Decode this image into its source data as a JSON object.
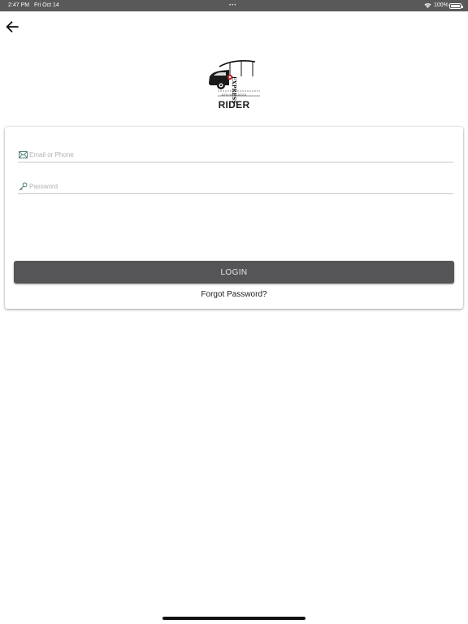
{
  "status_bar": {
    "time": "2:47 PM",
    "date": "Fri Oct 14",
    "dots": "•••",
    "battery_pct": "100%",
    "icons": [
      "wifi-icon",
      "battery-icon"
    ]
  },
  "nav": {
    "back_icon": "arrow-left-icon"
  },
  "logo": {
    "brand_text": "EXPRESS",
    "phone_text": "425-603-4026",
    "subtitle": "RIDER"
  },
  "form": {
    "email": {
      "placeholder": "Email or Phone",
      "value": "",
      "icon": "envelope-icon"
    },
    "password": {
      "placeholder": "Password",
      "value": "",
      "icon": "key-icon"
    },
    "login_label": "LOGIN",
    "forgot_label": "Forgot Password?"
  },
  "colors": {
    "status_bar_bg": "#595959",
    "button_bg": "#555457",
    "button_text": "#e6e6e6",
    "underline": "#c8c8c8"
  }
}
